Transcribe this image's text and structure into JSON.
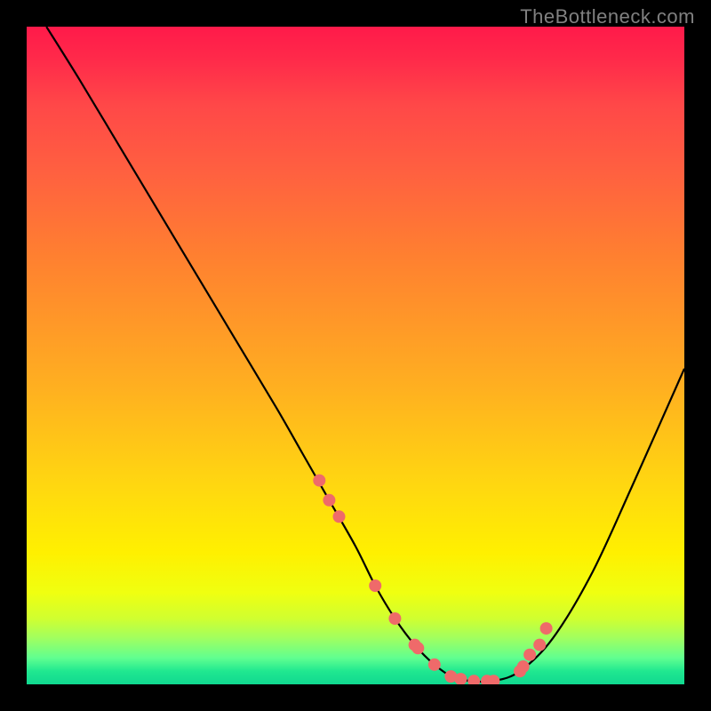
{
  "watermark": "TheBottleneck.com",
  "chart_data": {
    "type": "line",
    "title": "",
    "xlabel": "",
    "ylabel": "",
    "xlim": [
      0,
      100
    ],
    "ylim": [
      0,
      100
    ],
    "curve": {
      "name": "bottleneck-curve",
      "color": "#000000",
      "x": [
        3,
        8,
        14,
        20,
        26,
        32,
        38,
        42,
        46,
        50,
        53,
        56,
        59,
        62,
        65,
        68,
        71,
        75,
        80,
        86,
        92,
        100
      ],
      "y": [
        100,
        92,
        82,
        72,
        62,
        52,
        42,
        35,
        28,
        21,
        15,
        10,
        6,
        3,
        1,
        0.5,
        0.5,
        2,
        7,
        17,
        30,
        48
      ]
    },
    "markers": {
      "name": "highlight-dots",
      "color": "#ef6a6a",
      "radius": 7,
      "x": [
        44.5,
        46,
        47.5,
        53,
        56,
        59,
        59.5,
        62,
        64.5,
        66,
        68,
        70,
        71,
        75,
        75.5,
        76.5,
        78,
        79
      ],
      "y": [
        31,
        28,
        25.5,
        15,
        10,
        6,
        5.5,
        3,
        1.2,
        0.8,
        0.5,
        0.5,
        0.5,
        2,
        2.7,
        4.5,
        6,
        8.5
      ]
    },
    "gradient_stops": [
      {
        "pct": 0,
        "color": "#ff1a4a"
      },
      {
        "pct": 22,
        "color": "#ff6040"
      },
      {
        "pct": 55,
        "color": "#ffb020"
      },
      {
        "pct": 80,
        "color": "#fff000"
      },
      {
        "pct": 93,
        "color": "#a0ff60"
      },
      {
        "pct": 100,
        "color": "#10d890"
      }
    ]
  }
}
